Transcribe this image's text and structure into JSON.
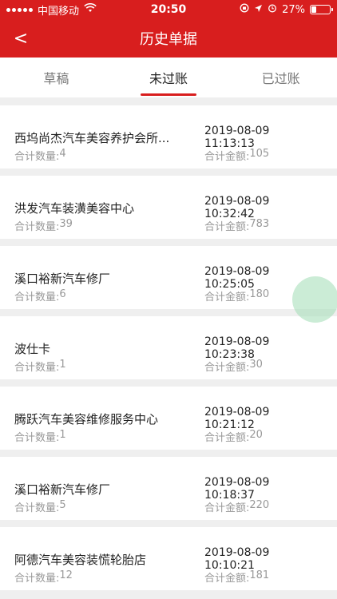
{
  "status_bar": {
    "carrier": "中国移动",
    "time": "20:50",
    "battery_text": "27%",
    "battery_level": 0.27
  },
  "nav": {
    "title": "历史单据",
    "back_label": "<"
  },
  "tabs": [
    {
      "label": "草稿",
      "active": false
    },
    {
      "label": "未过账",
      "active": true
    },
    {
      "label": "已过账",
      "active": false
    }
  ],
  "records": [
    {
      "name": "西坞尚杰汽车美容养护会所...",
      "time": "2019-08-09 11:13:13",
      "count_label": "合计数量:",
      "count": "4",
      "amount_label": "合计金额:",
      "amount": "105"
    },
    {
      "name": "洪发汽车装潢美容中心",
      "time": "2019-08-09 10:32:42",
      "count_label": "合计数量:",
      "count": "39",
      "amount_label": "合计金额:",
      "amount": "783"
    },
    {
      "name": "溪口裕新汽车修厂",
      "time": "2019-08-09 10:25:05",
      "count_label": "合计数量:",
      "count": "6",
      "amount_label": "合计金额:",
      "amount": "180"
    },
    {
      "name": "波仕卡",
      "time": "2019-08-09 10:23:38",
      "count_label": "合计数量:",
      "count": "1",
      "amount_label": "合计金额:",
      "amount": "30"
    },
    {
      "name": "腾跃汽车美容维修服务中心",
      "time": "2019-08-09 10:21:12",
      "count_label": "合计数量:",
      "count": "1",
      "amount_label": "合计金额:",
      "amount": "20"
    },
    {
      "name": "溪口裕新汽车修厂",
      "time": "2019-08-09 10:18:37",
      "count_label": "合计数量:",
      "count": "5",
      "amount_label": "合计金额:",
      "amount": "220"
    },
    {
      "name": "阿德汽车美容装慌轮胎店",
      "time": "2019-08-09 10:10:21",
      "count_label": "合计数量:",
      "count": "12",
      "amount_label": "合计金额:",
      "amount": "181"
    }
  ],
  "colors": {
    "brand": "#d81e1e",
    "float_ball": "#a0dcb4"
  }
}
